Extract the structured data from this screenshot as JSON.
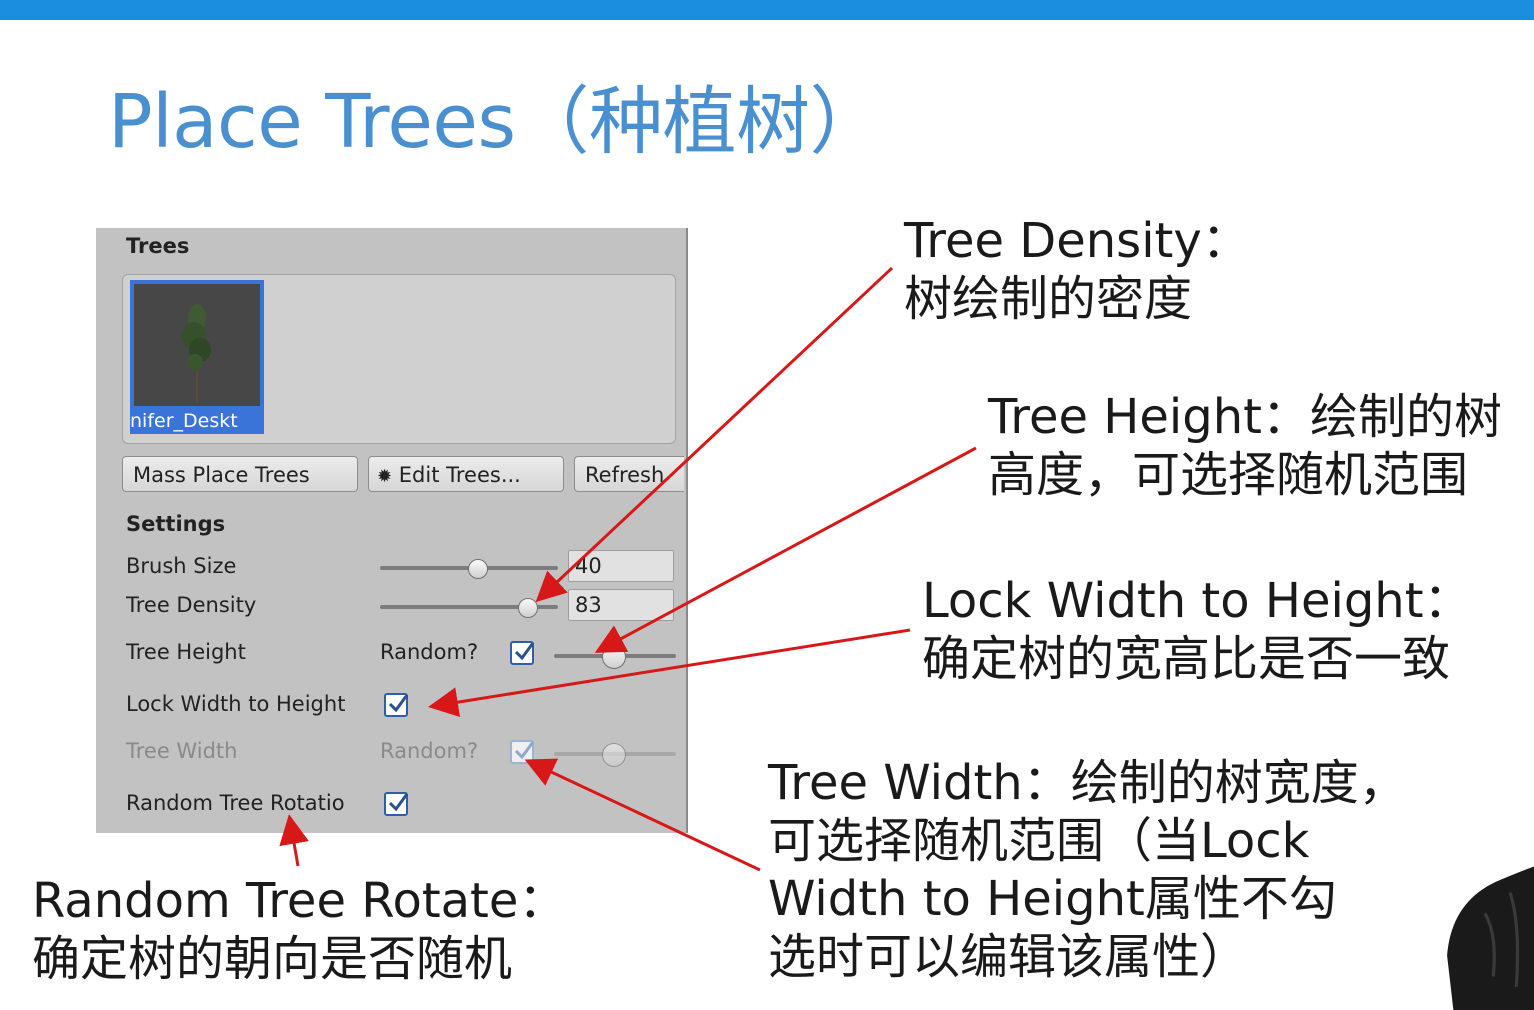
{
  "slide": {
    "title": "Place Trees（种植树）"
  },
  "panel": {
    "header": "Trees",
    "tree_thumbnail_label": "nifer_Deskt",
    "buttons": {
      "mass_place": "Mass Place Trees",
      "edit_trees": "Edit Trees...",
      "refresh": "Refresh"
    },
    "settings_header": "Settings",
    "brush_size": {
      "label": "Brush Size",
      "value": "40",
      "slider_fraction": 0.55
    },
    "tree_density": {
      "label": "Tree Density",
      "value": "83",
      "slider_fraction": 0.83
    },
    "tree_height": {
      "label": "Tree Height",
      "random_label": "Random?",
      "random_checked": true
    },
    "lock_width": {
      "label": "Lock Width to Height",
      "checked": true
    },
    "tree_width": {
      "label": "Tree Width",
      "random_label": "Random?",
      "random_checked": true,
      "disabled": true
    },
    "random_rotation": {
      "label": "Random Tree Rotatio",
      "checked": true
    }
  },
  "annotations": {
    "tree_density": [
      "Tree Density：",
      "树绘制的密度"
    ],
    "tree_height": [
      "Tree Height：绘制的树",
      "高度，可选择随机范围"
    ],
    "lock_width": [
      "Lock Width to Height：",
      "确定树的宽高比是否一致"
    ],
    "tree_width": [
      "Tree Width：绘制的树宽度，",
      "可选择随机范围（当Lock",
      "Width to Height属性不勾",
      "选时可以编辑该属性）"
    ],
    "random_rotate": [
      "Random Tree Rotate：",
      "确定树的朝向是否随机"
    ]
  },
  "colors": {
    "topbar": "#1c8ee0",
    "title": "#4a8fd0",
    "arrow": "#d81818",
    "panel_bg": "#c2c2c2",
    "selection": "#3a74d8"
  },
  "icons": [
    "gear-icon",
    "checkmark-icon",
    "tree-icon"
  ]
}
